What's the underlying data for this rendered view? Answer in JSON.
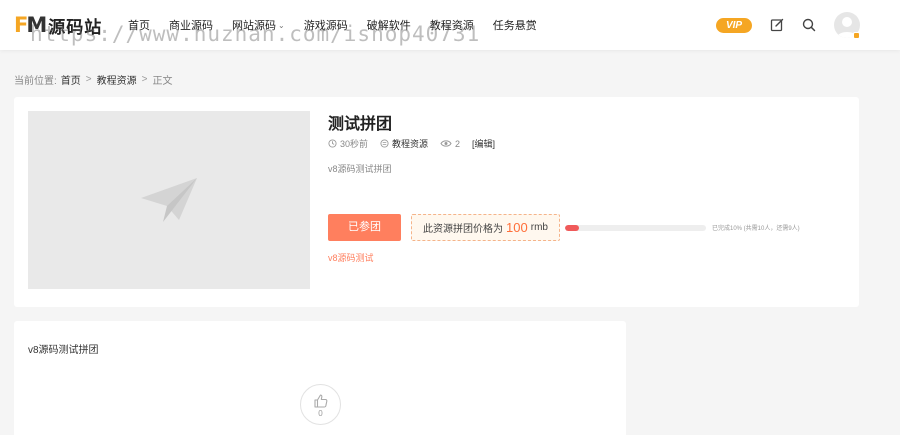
{
  "header": {
    "logo_mark_f": "F",
    "logo_mark_m": "M",
    "logo_text": "源码站",
    "nav": [
      {
        "label": "首页",
        "dropdown": false
      },
      {
        "label": "商业源码",
        "dropdown": false
      },
      {
        "label": "网站源码",
        "dropdown": true
      },
      {
        "label": "游戏源码",
        "dropdown": false
      },
      {
        "label": "破解软件",
        "dropdown": false
      },
      {
        "label": "教程资源",
        "dropdown": false
      },
      {
        "label": "任务悬赏",
        "dropdown": false
      }
    ],
    "watermark": "https://www.huzhan.com/ishop40731",
    "vip_label": "VIP",
    "icons": [
      "edit-icon",
      "search-icon",
      "avatar-icon"
    ],
    "accent_color": "#f5a623"
  },
  "breadcrumb": {
    "prefix": "当前位置:",
    "items": [
      "首页",
      "教程资源"
    ],
    "separator": ">",
    "current": "正文"
  },
  "post": {
    "title": "测试拼团",
    "time": "30秒前",
    "category": "教程资源",
    "views": "2",
    "edit_label": "[编辑]",
    "excerpt": "v8源码测试拼团",
    "join_label": "已参团",
    "price_prefix": "此资源拼团价格为",
    "price_value": "100",
    "price_unit": "rmb",
    "progress_fraction": 0.1,
    "progress_text": "已完成10% (共需10人，还需9人)",
    "tagline": "v8源码测试",
    "button_color": "#ff7f5e"
  },
  "content": {
    "text": "v8源码测试拼团",
    "like_count": "0"
  }
}
